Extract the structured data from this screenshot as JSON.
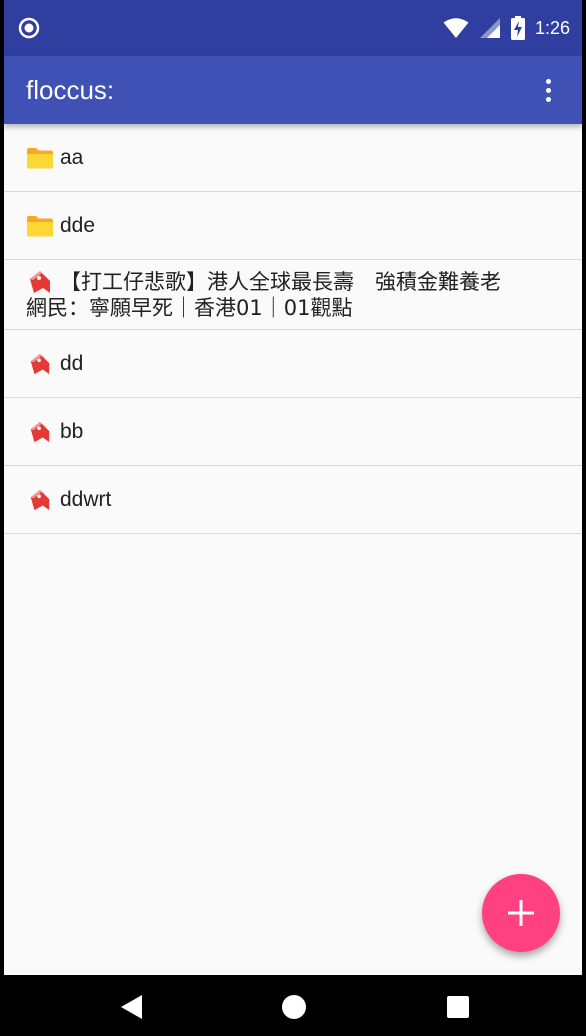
{
  "status_bar": {
    "time": "1:26",
    "icons": [
      "notification-circle-icon",
      "wifi-icon",
      "cellular-signal-icon",
      "battery-charging-icon"
    ]
  },
  "app_bar": {
    "title": "floccus:",
    "menu_icon": "more-vert-icon"
  },
  "items": [
    {
      "type": "folder",
      "label": "aa"
    },
    {
      "type": "folder",
      "label": "dde"
    },
    {
      "type": "bookmark",
      "label_line1": "【打工仔悲歌】港人全球最長壽　強積金難養老",
      "label_line2": "網民：寧願早死｜香港01｜01觀點"
    },
    {
      "type": "bookmark",
      "label": "dd"
    },
    {
      "type": "bookmark",
      "label": "bb"
    },
    {
      "type": "bookmark",
      "label": "ddwrt"
    }
  ],
  "fab": {
    "icon": "plus-icon"
  },
  "nav_bar": {
    "icons": [
      "back-icon",
      "home-icon",
      "recents-icon"
    ]
  },
  "colors": {
    "status_bar": "#303f9f",
    "app_bar": "#3f51b5",
    "accent": "#ff4081",
    "folder": "#fbc02d",
    "bookmark": "#e53935"
  }
}
